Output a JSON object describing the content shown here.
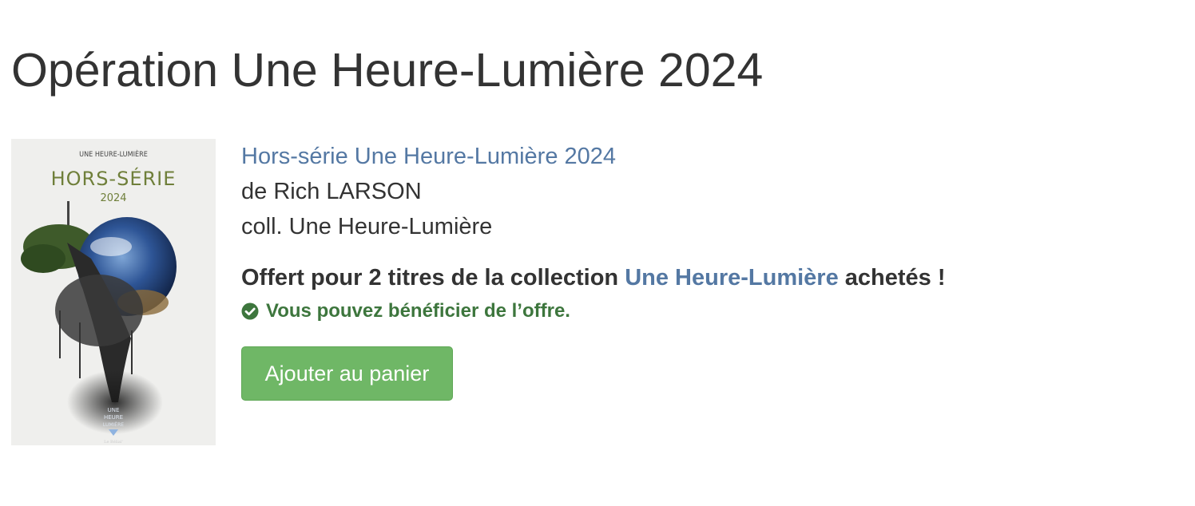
{
  "page": {
    "title": "Opération Une Heure-Lumière 2024"
  },
  "book": {
    "title": "Hors-série Une Heure-Lumière 2024",
    "author_line": "de Rich LARSON",
    "collection_line": "coll. Une Heure-Lumière",
    "cover": {
      "series_name": "UNE HEURE-LUMIÈRE",
      "headline": "HORS-SÉRIE",
      "year": "2024",
      "logo_line1": "UNE",
      "logo_line2": "HEURE",
      "logo_line3": "LUMIÈRE",
      "publisher": "Le Bélial'"
    }
  },
  "offer": {
    "text_before": "Offert pour 2 titres de la collection ",
    "collection_link": "Une Heure-Lumière",
    "text_after": " achetés !",
    "eligibility_icon": "check-circle-icon",
    "eligibility_text": "Vous pouvez bénéficier de l’offre."
  },
  "actions": {
    "add_to_cart_label": "Ajouter au panier"
  },
  "colors": {
    "link": "#5478a3",
    "success_text": "#3d763d",
    "button_bg": "#6fb766",
    "text": "#333333"
  }
}
